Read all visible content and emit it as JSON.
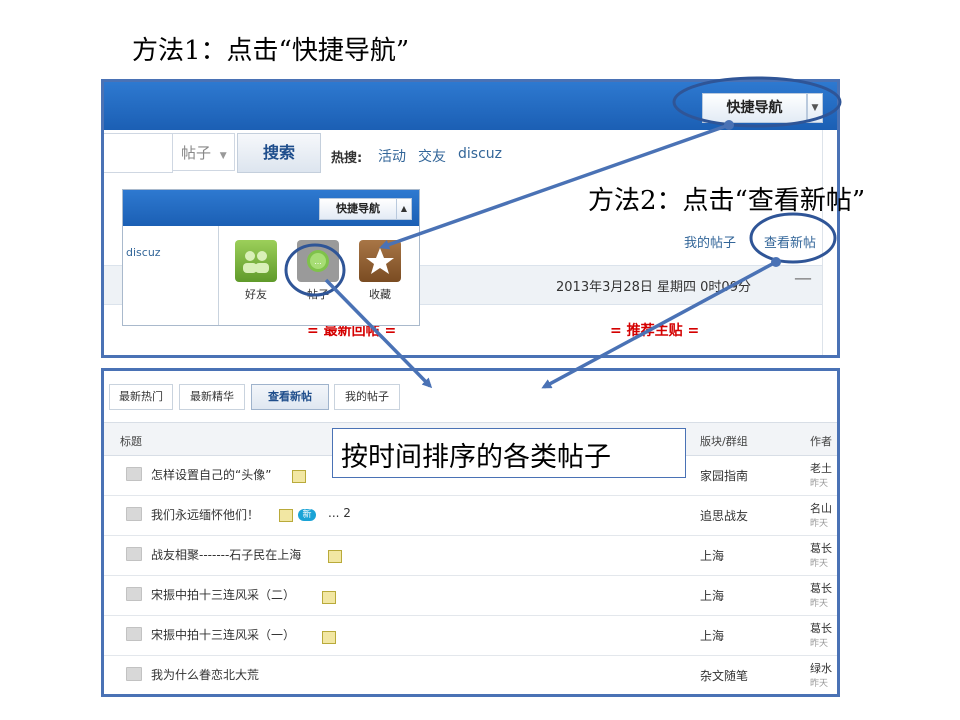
{
  "annotations": {
    "method1": "方法1：点击“快捷导航”",
    "method2": "方法2：点击“查看新帖”",
    "callout": "按时间排序的各类帖子"
  },
  "top": {
    "quicknav_label": "快捷导航",
    "search": {
      "scope": "帖子",
      "button": "搜索"
    },
    "hot": {
      "label": "热搜:",
      "links": [
        "活动",
        "交友",
        "discuz"
      ]
    },
    "nav_links": {
      "my_posts": "我的帖子",
      "new_posts": "查看新帖"
    },
    "date_text": "2013年3月28日 星期四 0时09分",
    "collapse": "—",
    "latest_heading": "= 最新回帖 =",
    "recommended_heading": "= 推荐主贴 ="
  },
  "inset": {
    "quicknav_label": "快捷导航",
    "side_text": "discuz",
    "items": [
      {
        "label": "好友",
        "icon": "friends-icon",
        "color": "#6aa234"
      },
      {
        "label": "帖子",
        "icon": "posts-icon",
        "color": "#8a8a8a"
      },
      {
        "label": "收藏",
        "icon": "favorites-star-icon",
        "color": "#8b5a2b"
      }
    ]
  },
  "bottom": {
    "tabs": [
      "最新热门",
      "最新精华",
      "查看新帖",
      "我的帖子"
    ],
    "active_tab": "查看新帖",
    "headers": {
      "title": "标题",
      "forum": "版块/群组",
      "author": "作者"
    },
    "rows": [
      {
        "title": "怎样设置自己的“头像”",
        "forum": "家园指南",
        "author": "老土",
        "time": "昨天"
      },
      {
        "title": "我们永远缅怀他们！",
        "forum": "追思战友",
        "author": "名山",
        "time": "昨天",
        "new_badge": "新",
        "pages": "... 2"
      },
      {
        "title": "战友相聚-------石子民在上海",
        "forum": "上海",
        "author": "葛长",
        "time": "昨天"
      },
      {
        "title": "宋振中拍十三连风采（二）",
        "forum": "上海",
        "author": "葛长",
        "time": "昨天"
      },
      {
        "title": "宋振中拍十三连风采（一）",
        "forum": "上海",
        "author": "葛长",
        "time": "昨天"
      },
      {
        "title": "我为什么眷恋北大荒",
        "forum": "杂文随笔",
        "author": "绿水",
        "time": "昨天"
      }
    ]
  },
  "colors": {
    "accent": "#4a72b5",
    "header_blue": "#1f6cc8",
    "red": "#d40000"
  }
}
